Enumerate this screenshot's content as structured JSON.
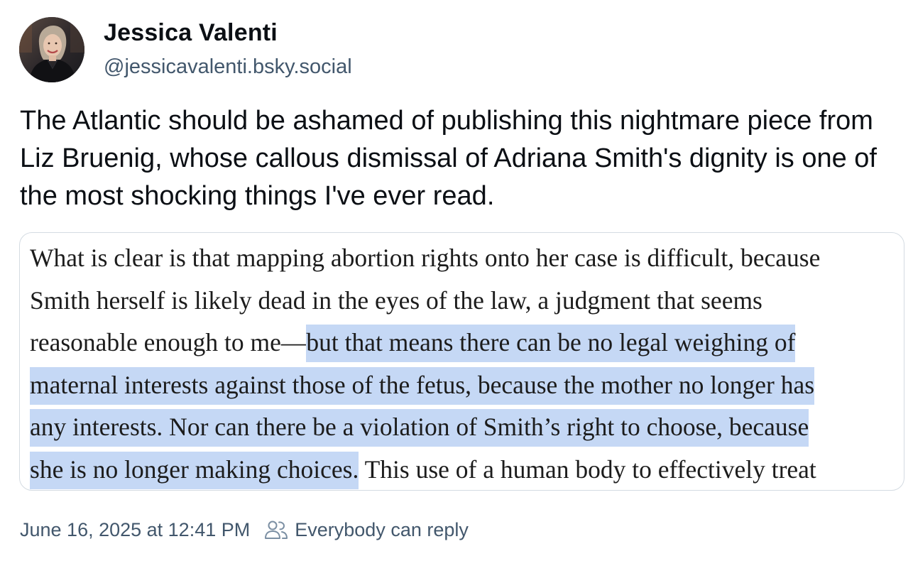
{
  "post": {
    "author": {
      "display_name": "Jessica Valenti",
      "handle": "@jessicavalenti.bsky.social",
      "avatar_icon": "avatar-photo"
    },
    "text": "The Atlantic should be ashamed of publishing this nightmare piece from Liz Bruenig, whose callous dismissal of Adriana Smith's dignity is one of the most shocking things I've ever read.",
    "embed_image": {
      "lines": [
        {
          "plain": "What is clear is that mapping abortion rights onto her case is difficult, because",
          "highlighted": ""
        },
        {
          "plain": "Smith herself is likely dead in the eyes of the law, a judgment that seems",
          "highlighted": ""
        },
        {
          "plain": "reasonable enough to me—",
          "highlighted": "but that means there can be no legal weighing of"
        },
        {
          "plain": "",
          "highlighted": "maternal interests against those of the fetus, because the mother no longer has"
        },
        {
          "plain": "",
          "highlighted": "any interests. Nor can there be a violation of Smith’s right to choose, because"
        },
        {
          "plain": "",
          "highlighted": "she is no longer making choices.",
          "trailing": " This use of a human body to effectively treat"
        }
      ],
      "highlight_color": "#c5d8f5"
    },
    "footer": {
      "timestamp": "June 16, 2025 at 12:41 PM",
      "reply_setting": "Everybody can reply",
      "reply_icon": "people-icon"
    }
  },
  "colors": {
    "text_primary": "#0b0f14",
    "text_secondary": "#42576c",
    "border": "#d4dbe2"
  }
}
